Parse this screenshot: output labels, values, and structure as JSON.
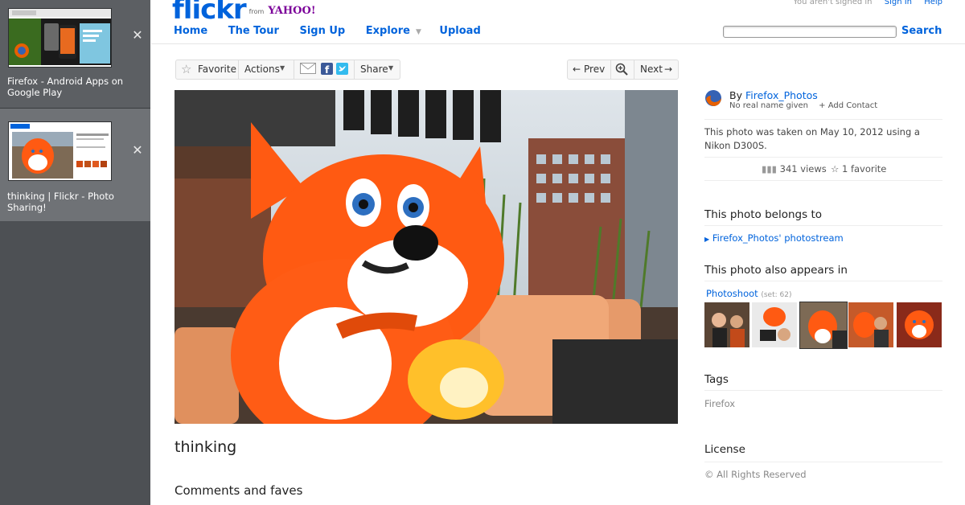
{
  "tabs": [
    {
      "title": "Firefox - Android Apps on Google Play",
      "close": "✕"
    },
    {
      "title": "thinking | Flickr - Photo Sharing!",
      "close": "✕"
    }
  ],
  "header": {
    "logo_text": "flickr",
    "logo_from": "from",
    "logo_yahoo": "YAHOO!",
    "signin_note": "You aren't signed in",
    "signin_link": "Sign In",
    "help_link": "Help",
    "nav": [
      "Home",
      "The Tour",
      "Sign Up",
      "Explore",
      "Upload"
    ],
    "search_placeholder": "",
    "search_button": "Search"
  },
  "toolbar": {
    "favorite": "Favorite",
    "actions": "Actions",
    "share": "Share",
    "prev": "Prev",
    "next": "Next"
  },
  "photo": {
    "title": "thinking",
    "comments_heading": "Comments and faves"
  },
  "sidebar_info": {
    "by_label": "By",
    "owner": "Firefox_Photos",
    "real_name": "No real name given",
    "add_contact": "+ Add Contact",
    "taken": "This photo was taken on May 10, 2012 using a Nikon D300S.",
    "views": "341 views",
    "favorites": "1 favorite",
    "belongs_heading": "This photo belongs to",
    "photostream": "Firefox_Photos' photostream",
    "appears_heading": "This photo also appears in",
    "set_name": "Photoshoot",
    "set_count": "(set: 62)",
    "tags_heading": "Tags",
    "tag": "Firefox",
    "license_heading": "License",
    "license": "All Rights Reserved"
  },
  "colors": {
    "link": "#0063dc",
    "flickr_pink": "#ff0084",
    "sidebar": "#4d5054"
  }
}
